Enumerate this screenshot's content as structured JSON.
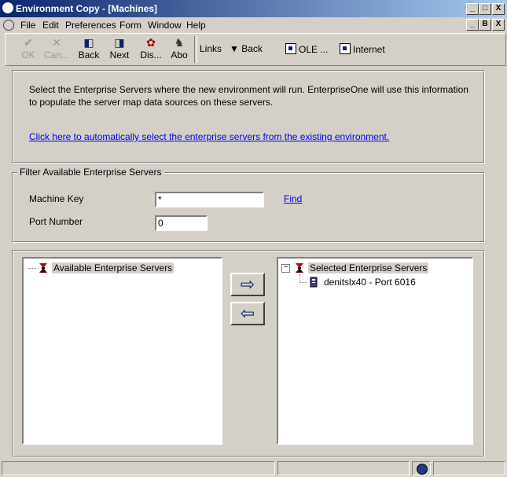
{
  "window": {
    "title": "Environment Copy - [Machines]",
    "caption_buttons": [
      "_",
      "□",
      "X"
    ],
    "mdi_buttons": [
      "_",
      "B",
      "X"
    ]
  },
  "menu": [
    {
      "label": "File",
      "underline": "F"
    },
    {
      "label": "Edit",
      "underline": "E"
    },
    {
      "label": "Preferences",
      "underline": "P"
    },
    {
      "label": "Form",
      "underline": "m"
    },
    {
      "label": "Window",
      "underline": "W"
    },
    {
      "label": "Help",
      "underline": "H"
    }
  ],
  "toolbar": {
    "ok_label": "OK",
    "cancel_label": "Can...",
    "back_label": "Back",
    "next_label": "Next",
    "display_label": "Dis...",
    "about_label": "Abo",
    "links_label": "Links",
    "links_back_label": "Back",
    "ole_label": "OLE ...",
    "internet_label": "Internet"
  },
  "instructions": {
    "text": "Select the Enterprise Servers where the new environment will run.  EnterpriseOne will use this information to populate the server map data sources on these servers.",
    "auto_select_link": "Click here to automatically select the enterprise servers from the existing environment."
  },
  "filter": {
    "legend": "Filter Available Enterprise Servers",
    "machine_key_label": "Machine Key",
    "machine_key_value": "*",
    "find_link": "Find",
    "port_number_label": "Port Number",
    "port_number_value": "0"
  },
  "available": {
    "root_label": "Available Enterprise Servers",
    "items": []
  },
  "selected": {
    "root_label": "Selected Enterprise Servers",
    "expander": "−",
    "items": [
      {
        "label": "denitslx40 - Port 6016"
      }
    ]
  },
  "arrows": {
    "add_glyph": "⇨",
    "remove_glyph": "⇦"
  },
  "colors": {
    "titlebar_start": "#0a246a",
    "titlebar_end": "#a6caf0",
    "window_bg": "#d4d0c8",
    "link": "#0000ee"
  }
}
